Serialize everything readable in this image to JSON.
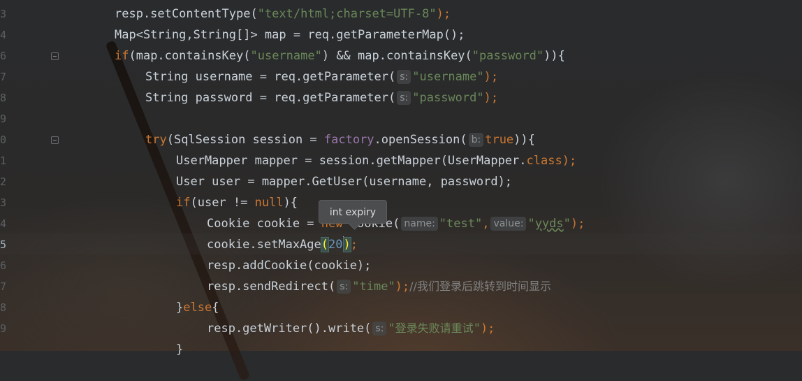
{
  "gutter": {
    "line_numbers": [
      "3",
      "4",
      "6",
      "7",
      "8",
      "9",
      "0",
      "1",
      "2",
      "3",
      "4",
      "5",
      "6",
      "7",
      "8",
      "9"
    ],
    "current_line": "5"
  },
  "code": {
    "l1": {
      "a": "resp.setContentType(",
      "b": "\"text/html;charset=UTF-8\"",
      "c": ");"
    },
    "l2": {
      "a": "Map<String,String[]> map = req.getParameterMap();"
    },
    "l3": {
      "kw": "if",
      "a": "(map.containsKey(",
      "b": "\"username\"",
      "c": ") && map.containsKey(",
      "d": "\"password\"",
      "e": ")){"
    },
    "l4": {
      "a": "String username = req.getParameter(",
      "hint": "s:",
      "b": "\"username\"",
      "c": ");"
    },
    "l5": {
      "a": "String password = req.getParameter(",
      "hint": "s:",
      "b": "\"password\"",
      "c": ");"
    },
    "l7": {
      "kw": "try",
      "a": "(SqlSession session = ",
      "field": "factory",
      "b": ".openSession(",
      "hint": "b:",
      "kw2": "true",
      "c": ")){"
    },
    "l8": {
      "a": "UserMapper mapper = session.getMapper(UserMapper.",
      "kw": "class",
      "b": ");"
    },
    "l9": {
      "a": "User user = mapper.GetUser(username, password);"
    },
    "l10": {
      "kw": "if",
      "a": "(user != ",
      "kw2": "null",
      "b": "){"
    },
    "l11": {
      "a": "Cookie cookie = ",
      "kw": "new",
      "b": " Cookie(",
      "hint1": "name:",
      "s1": "\"test\"",
      "comma": ",",
      "hint2": "value:",
      "s2q1": "\"",
      "s2": "yyds",
      "s2q2": "\"",
      "c": ");"
    },
    "l12": {
      "a": "cookie.setMaxAge",
      "p1": "(",
      "num": "20",
      "p2": ")",
      "c": ";"
    },
    "l13": {
      "a": "resp.addCookie(cookie);"
    },
    "l14": {
      "a": "resp.sendRedirect(",
      "hint": "s:",
      "b": "\"time\"",
      "c": ");",
      "comment": "//我们登录后跳转到时间显示"
    },
    "l15": {
      "a": "}",
      "kw": "else",
      "b": "{"
    },
    "l16": {
      "a": "resp.getWriter().write(",
      "hint": "s:",
      "q1": "\"",
      "b": "登录失败请重试",
      "q2": "\"",
      "c": ");"
    },
    "l17": {
      "a": "}"
    }
  },
  "tooltip": {
    "text": "int expiry"
  }
}
